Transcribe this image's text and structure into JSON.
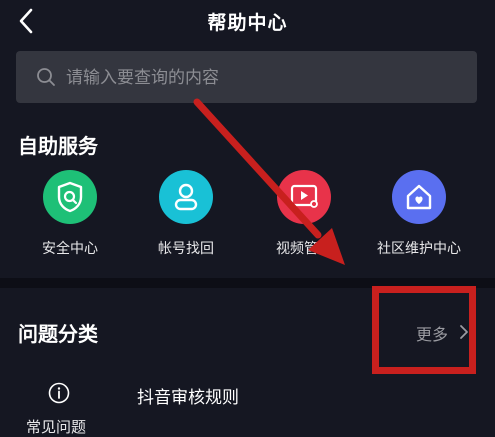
{
  "header": {
    "title": "帮助中心",
    "back_icon": "chevron-left-icon"
  },
  "search": {
    "placeholder": "请输入要查询的内容",
    "icon": "search-icon"
  },
  "self_service": {
    "title": "自助服务",
    "items": [
      {
        "label": "安全中心",
        "icon": "shield-search-icon",
        "color": "#1ec077"
      },
      {
        "label": "帐号找回",
        "icon": "user-icon",
        "color": "#19c1d6"
      },
      {
        "label": "视频管理",
        "icon": "video-settings-icon",
        "color": "#e8334a"
      },
      {
        "label": "社区维护中心",
        "icon": "home-heart-icon",
        "color": "#5a6ff0"
      }
    ]
  },
  "categories": {
    "title": "问题分类",
    "more_label": "更多",
    "more_icon": "chevron-right-icon",
    "faq": {
      "label": "常见问题",
      "icon": "info-circle-icon",
      "first_item": "抖音审核规则"
    }
  },
  "annotation": {
    "arrow_color": "#c8201e",
    "box_color": "#c8201e"
  }
}
